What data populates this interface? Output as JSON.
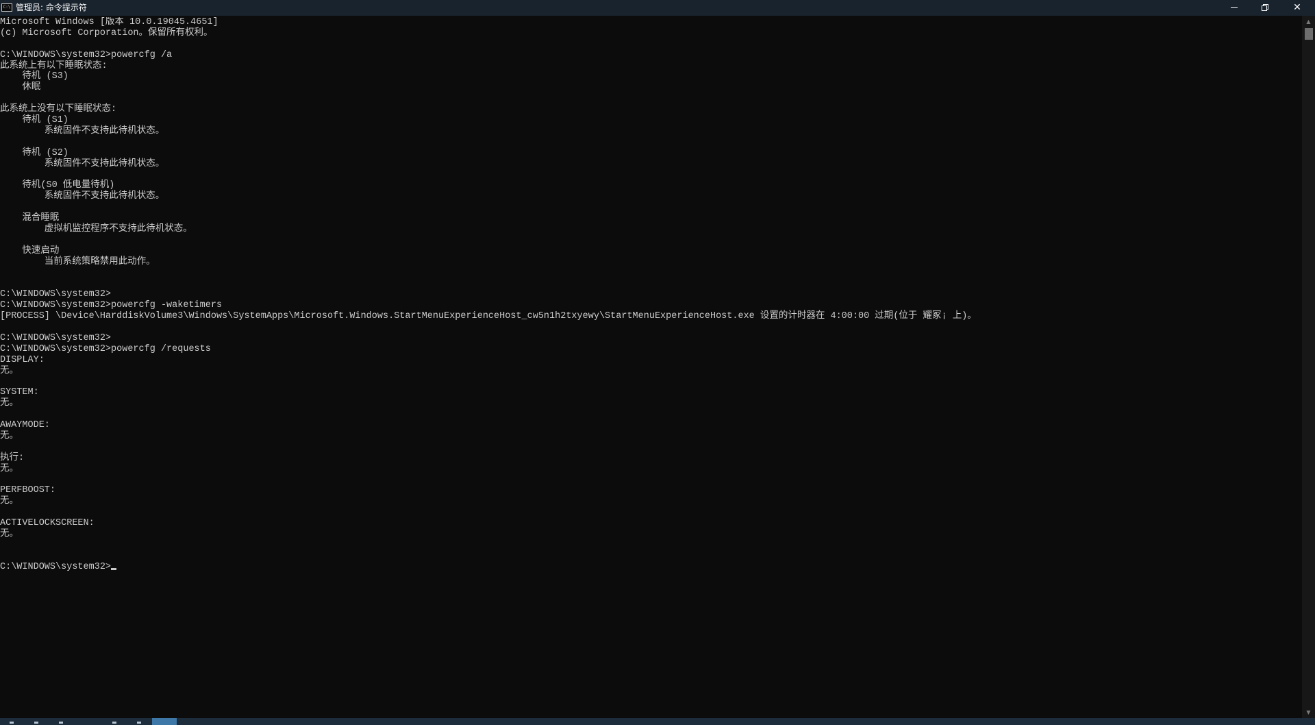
{
  "window": {
    "title": "管理员: 命令提示符",
    "icon": "console-app-icon",
    "controls": {
      "minimize": "minimize-icon",
      "restore": "restore-icon",
      "close": "close-icon",
      "close_glyph": "✕"
    }
  },
  "console": {
    "lines": [
      "Microsoft Windows [版本 10.0.19045.4651]",
      "(c) Microsoft Corporation。保留所有权利。",
      "",
      "C:\\WINDOWS\\system32>powercfg /a",
      "此系统上有以下睡眠状态:",
      "    待机 (S3)",
      "    休眠",
      "",
      "此系统上没有以下睡眠状态:",
      "    待机 (S1)",
      "        系统固件不支持此待机状态。",
      "",
      "    待机 (S2)",
      "        系统固件不支持此待机状态。",
      "",
      "    待机(S0 低电量待机)",
      "        系统固件不支持此待机状态。",
      "",
      "    混合睡眠",
      "        虚拟机监控程序不支持此待机状态。",
      "",
      "    快速启动",
      "        当前系统策略禁用此动作。",
      "",
      "",
      "C:\\WINDOWS\\system32>",
      "C:\\WINDOWS\\system32>powercfg -waketimers",
      "[PROCESS] \\Device\\HarddiskVolume3\\Windows\\SystemApps\\Microsoft.Windows.StartMenuExperienceHost_cw5n1h2txyewy\\StartMenuExperienceHost.exe 设置的计时器在 4:00:00 过期(位于 耀冢¡ 上)。",
      "",
      "C:\\WINDOWS\\system32>",
      "C:\\WINDOWS\\system32>powercfg /requests",
      "DISPLAY:",
      "无。",
      "",
      "SYSTEM:",
      "无。",
      "",
      "AWAYMODE:",
      "无。",
      "",
      "执行:",
      "无。",
      "",
      "PERFBOOST:",
      "无。",
      "",
      "ACTIVELOCKSCREEN:",
      "无。",
      "",
      ""
    ],
    "prompt": "C:\\WINDOWS\\system32>"
  },
  "scrollbar": {
    "up_arrow": "▲",
    "down_arrow": "▼",
    "position": 0
  },
  "colors": {
    "background": "#0c0c0c",
    "text": "#cccccc",
    "titlebar": "#19232d"
  }
}
